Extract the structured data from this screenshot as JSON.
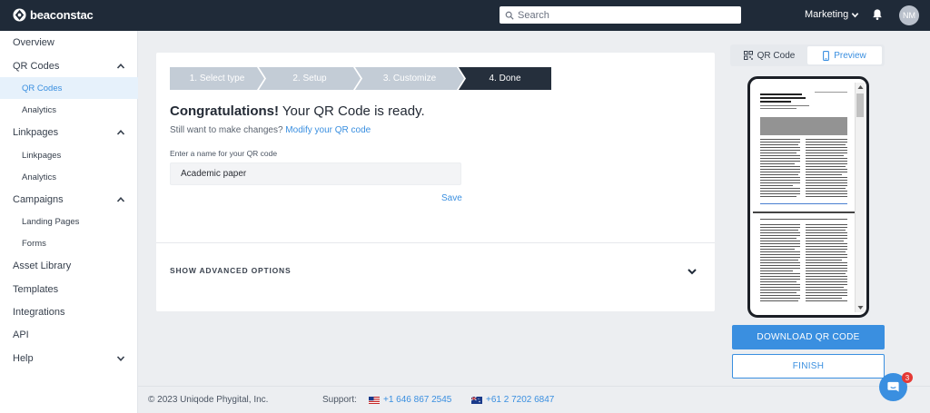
{
  "brand": {
    "name": "beaconstac"
  },
  "header": {
    "search_placeholder": "Search",
    "workspace": "Marketing",
    "avatar_initials": "NM"
  },
  "sidebar": {
    "items": [
      {
        "label": "Overview"
      },
      {
        "label": "QR Codes"
      },
      {
        "label": "QR Codes"
      },
      {
        "label": "Analytics"
      },
      {
        "label": "Linkpages"
      },
      {
        "label": "Linkpages"
      },
      {
        "label": "Analytics"
      },
      {
        "label": "Campaigns"
      },
      {
        "label": "Landing Pages"
      },
      {
        "label": "Forms"
      },
      {
        "label": "Asset Library"
      },
      {
        "label": "Templates"
      },
      {
        "label": "Integrations"
      },
      {
        "label": "API"
      },
      {
        "label": "Help"
      }
    ]
  },
  "wizard": {
    "steps": [
      "1. Select type",
      "2. Setup",
      "3. Customize",
      "4. Done"
    ],
    "current_step": 4,
    "congrats_bold": "Congratulations!",
    "congrats_rest": " Your QR Code is ready.",
    "still_text": "Still want to make changes? ",
    "modify_link": "Modify your QR code",
    "name_label": "Enter a name for your QR code",
    "name_value": "Academic paper",
    "save_label": "Save",
    "advanced_label": "SHOW ADVANCED OPTIONS"
  },
  "preview": {
    "tab_qr": "QR Code",
    "tab_preview": "Preview",
    "active_tab": "Preview",
    "paper_title": "The mitotic spindle is required for loading of the DASH complex onto the kinetochore",
    "download_label": "DOWNLOAD QR CODE",
    "finish_label": "FINISH"
  },
  "footer": {
    "copyright": "© 2023 Uniqode Phygital, Inc.",
    "support_label": "Support:",
    "phone_us": "+1 646 867 2545",
    "phone_au": "+61 2 7202 6847"
  },
  "chat": {
    "badge_count": "3"
  },
  "colors": {
    "accent": "#3a8fe0",
    "topbar": "#1f2a38",
    "step_done": "#252f3c",
    "step_pending": "#c3ccd6"
  }
}
